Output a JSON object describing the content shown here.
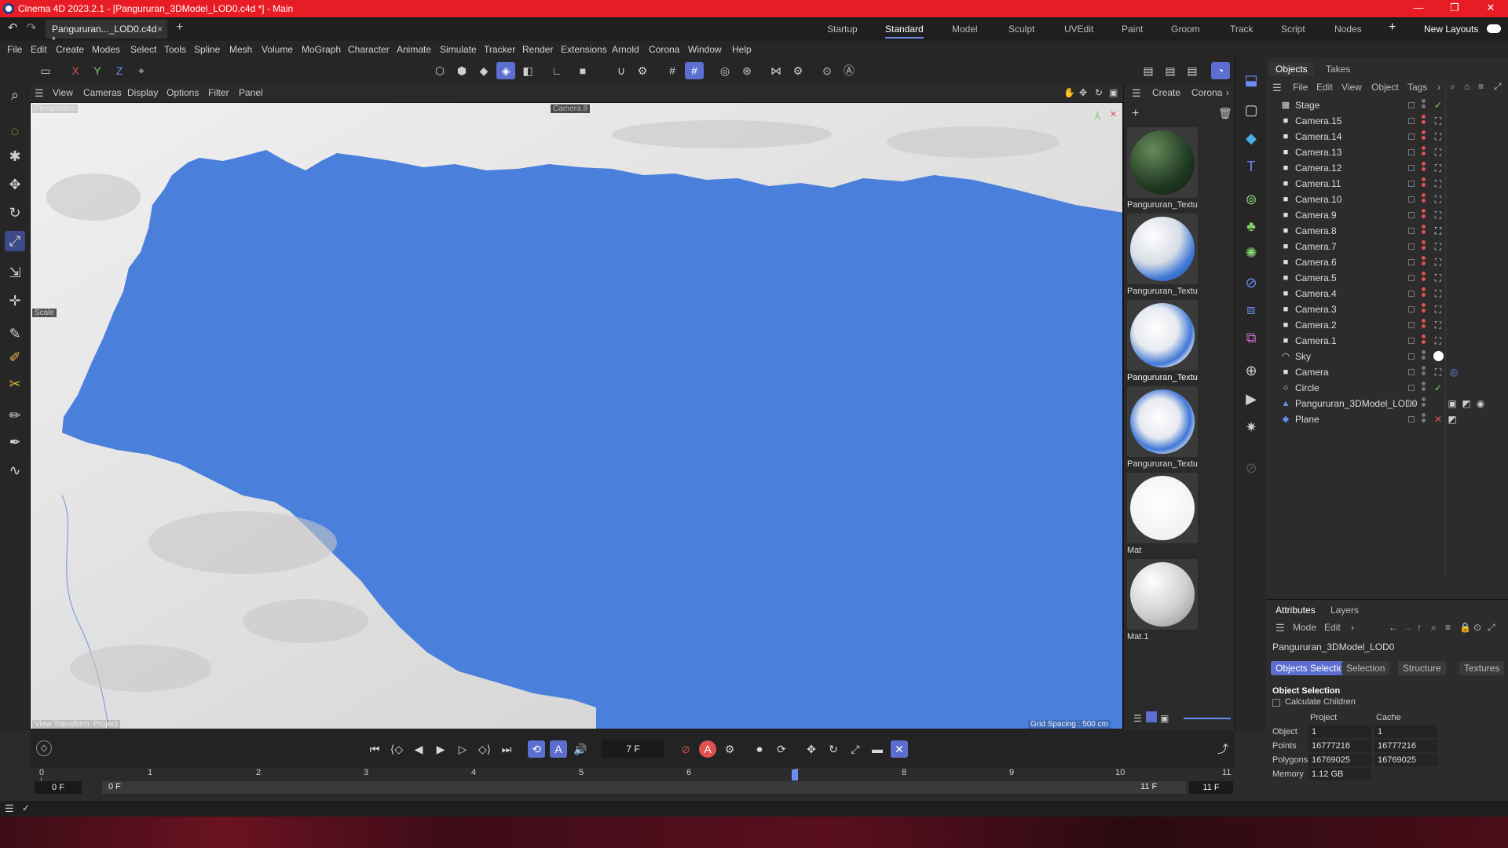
{
  "titlebar": {
    "title": "Cinema 4D 2023.2.1 - [Pangururan_3DModel_LOD0.c4d *] - Main",
    "minimize": "—",
    "restore": "❐",
    "close": "✕"
  },
  "tabs": {
    "doc_tab": "Pangururan..._LOD0.c4d *",
    "close": "×",
    "add": "+"
  },
  "layouts": {
    "items": [
      "Startup",
      "Standard",
      "Model",
      "Sculpt",
      "UVEdit",
      "Paint",
      "Groom",
      "Track",
      "Script",
      "Nodes"
    ],
    "active": "Standard",
    "add": "+",
    "new_layouts": "New Layouts"
  },
  "menu": [
    "File",
    "Edit",
    "Create",
    "Modes",
    "Select",
    "Tools",
    "Spline",
    "Mesh",
    "Volume",
    "MoGraph",
    "Character",
    "Animate",
    "Simulate",
    "Tracker",
    "Render",
    "Extensions",
    "Arnold",
    "Corona",
    "Window",
    "Help"
  ],
  "axis_toggles": [
    "X",
    "Y",
    "Z"
  ],
  "viewport": {
    "menu": [
      "View",
      "Cameras",
      "Display",
      "Options",
      "Filter",
      "Panel"
    ],
    "view_name": "Perspective",
    "camera_label": "Camera.8",
    "tool_label": "Scale",
    "view_transform": "View Transform: Project",
    "grid_spacing": "Grid Spacing : 500 cm",
    "colors": {
      "lake": "#4a7fdc",
      "terrain": "#e6e6e6"
    }
  },
  "materials": {
    "menu": [
      "Create",
      "Corona"
    ],
    "items": [
      {
        "name": "Pangururan_Textu",
        "style": "dark-green"
      },
      {
        "name": "Pangururan_Textu",
        "style": "blue-white"
      },
      {
        "name": "Pangururan_Textu",
        "style": "blue-white"
      },
      {
        "name": "Pangururan_Textu",
        "style": "blue-white"
      },
      {
        "name": "Mat",
        "style": "white"
      },
      {
        "name": "Mat.1",
        "style": "grey"
      }
    ]
  },
  "objects": {
    "tabs": [
      "Objects",
      "Takes"
    ],
    "menu": [
      "File",
      "Edit",
      "View",
      "Object",
      "Tags"
    ],
    "rows": [
      {
        "name": "Stage",
        "icon": "stage-icon",
        "tag": "check"
      },
      {
        "name": "Camera.15",
        "icon": "camera-icon",
        "tag": "target"
      },
      {
        "name": "Camera.14",
        "icon": "camera-icon",
        "tag": "target"
      },
      {
        "name": "Camera.13",
        "icon": "camera-icon",
        "tag": "target"
      },
      {
        "name": "Camera.12",
        "icon": "camera-icon",
        "tag": "target"
      },
      {
        "name": "Camera.11",
        "icon": "camera-icon",
        "tag": "target"
      },
      {
        "name": "Camera.10",
        "icon": "camera-icon",
        "tag": "target"
      },
      {
        "name": "Camera.9",
        "icon": "camera-icon",
        "tag": "target"
      },
      {
        "name": "Camera.8",
        "icon": "camera-icon",
        "tag": "target-active"
      },
      {
        "name": "Camera.7",
        "icon": "camera-icon",
        "tag": "target"
      },
      {
        "name": "Camera.6",
        "icon": "camera-icon",
        "tag": "target"
      },
      {
        "name": "Camera.5",
        "icon": "camera-icon",
        "tag": "target"
      },
      {
        "name": "Camera.4",
        "icon": "camera-icon",
        "tag": "target"
      },
      {
        "name": "Camera.3",
        "icon": "camera-icon",
        "tag": "target"
      },
      {
        "name": "Camera.2",
        "icon": "camera-icon",
        "tag": "target"
      },
      {
        "name": "Camera.1",
        "icon": "camera-icon",
        "tag": "target"
      },
      {
        "name": "Sky",
        "icon": "sky-icon",
        "tag": "sky-ball"
      },
      {
        "name": "Camera",
        "icon": "camera-icon",
        "tag": "target"
      },
      {
        "name": "Circle",
        "icon": "circle-icon",
        "tag": "check"
      },
      {
        "name": "Pangururan_3DModel_LOD0",
        "icon": "polygon-icon",
        "tag": "materials"
      },
      {
        "name": "Plane",
        "icon": "plane-icon",
        "tag": "cross"
      }
    ]
  },
  "attributes": {
    "tabs": [
      "Attributes",
      "Layers"
    ],
    "menu": [
      "Mode",
      "Edit"
    ],
    "object_name": "Pangururan_3DModel_LOD0",
    "subtabs": [
      "Objects Selection",
      "Selection",
      "Structure",
      "Textures"
    ],
    "section": "Object Selection",
    "calc_children": "Calculate Children",
    "headers": [
      "Project",
      "Cache"
    ],
    "rows": [
      {
        "label": "Object",
        "project": "1",
        "cache": "1"
      },
      {
        "label": "Points",
        "project": "16777216",
        "cache": "16777216"
      },
      {
        "label": "Polygons",
        "project": "16769025",
        "cache": "16769025"
      },
      {
        "label": "Memory",
        "project": "1.12 GB",
        "cache": ""
      }
    ]
  },
  "timeline": {
    "current_frame": "7 F",
    "ticks": [
      "0",
      "1",
      "2",
      "3",
      "4",
      "5",
      "6",
      "7",
      "8",
      "9",
      "10",
      "11"
    ],
    "playhead": 7,
    "start_a": "0 F",
    "start_b": "0 F",
    "end_a": "11 F",
    "end_b": "11 F"
  }
}
